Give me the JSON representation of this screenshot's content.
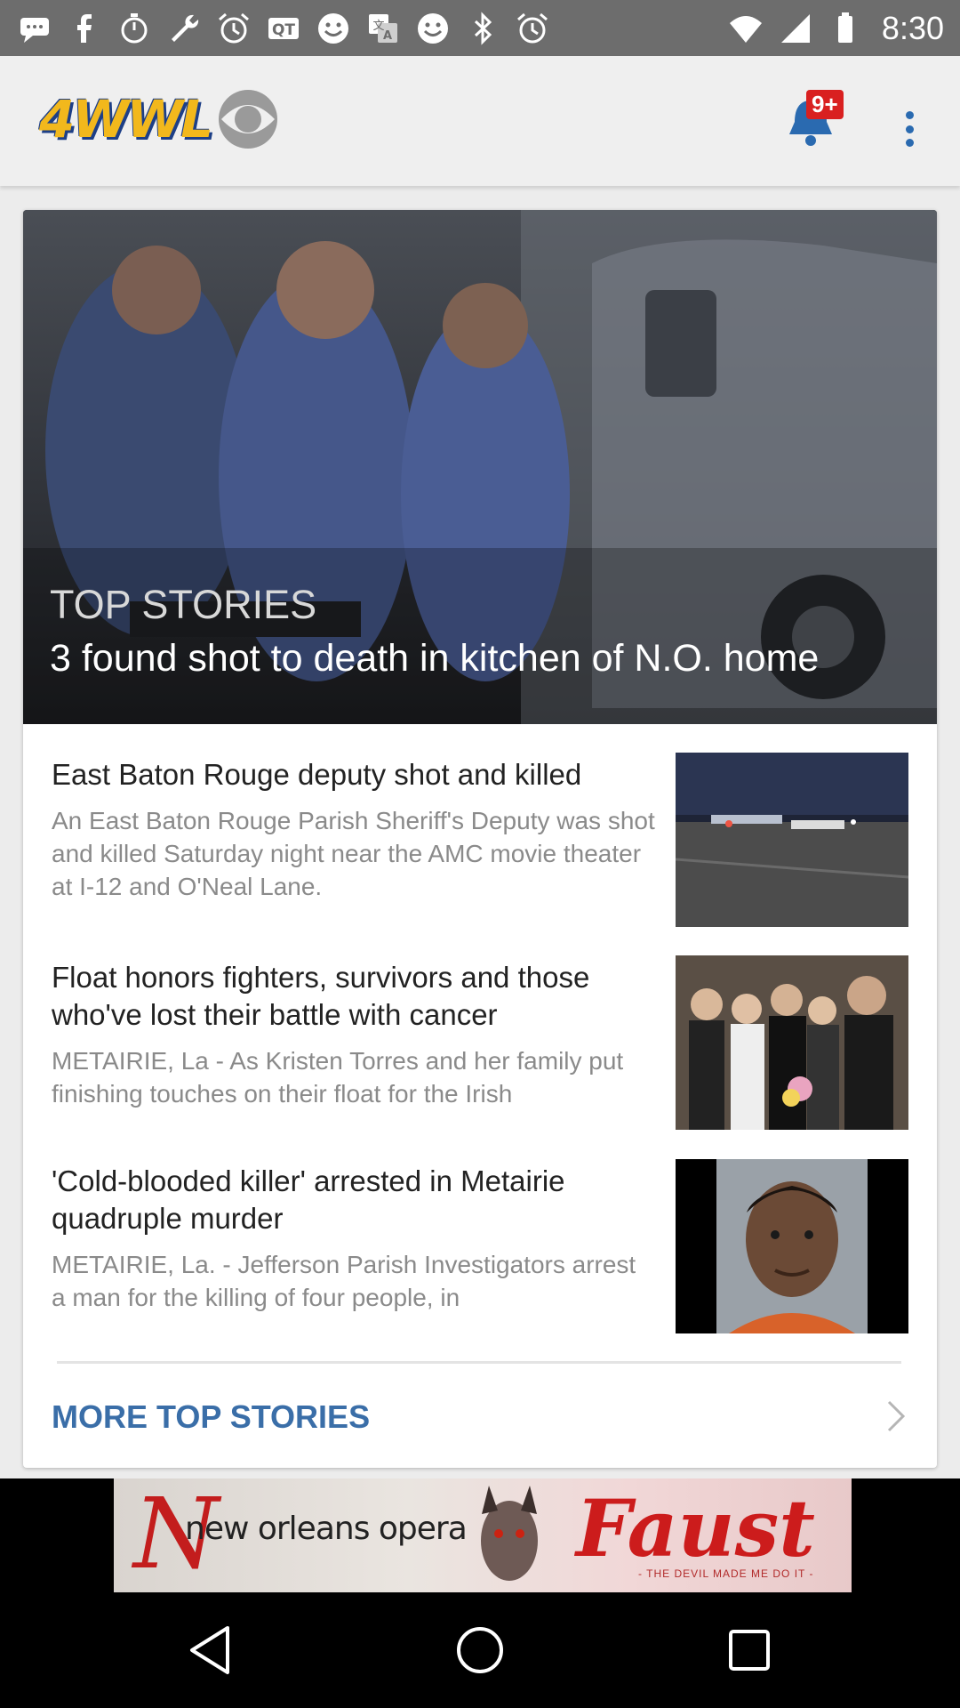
{
  "status_bar": {
    "time": "8:30",
    "left_icons": [
      "chat-bubble-icon",
      "facebook-icon",
      "timer-icon",
      "wrench-icon",
      "alarm-icon",
      "qt-icon",
      "smiley-icon",
      "translate-icon",
      "smiley-icon",
      "bluetooth-icon",
      "alarm-icon"
    ],
    "right_icons": [
      "wifi-icon",
      "signal-icon",
      "battery-icon"
    ]
  },
  "app_bar": {
    "logo_text": "4WWL",
    "notification_badge": "9+",
    "colors": {
      "logo_gold": "#f2b81c",
      "logo_blue": "#1d3f87",
      "accent_blue": "#2a6ab0",
      "badge_red": "#d92020"
    }
  },
  "hero": {
    "kicker": "TOP STORIES",
    "title": "3 found shot to death in kitchen of N.O. home"
  },
  "stories": [
    {
      "title": "East Baton Rouge deputy shot and killed",
      "summary": "An East Baton Rouge Parish Sheriff's Deputy was shot and killed Saturday night near the AMC movie theater at I-12 and O'Neal Lane."
    },
    {
      "title": "Float honors fighters, survivors and those who've lost their battle with cancer",
      "summary": "METAIRIE, La - As Kristen Torres and her family put finishing touches on their float for the Irish"
    },
    {
      "title": "'Cold-blooded killer' arrested in Metairie quadruple murder",
      "summary": "METAIRIE, La. - Jefferson Parish Investigators arrest a man for the killing of four people, in"
    }
  ],
  "more_link": {
    "label": "MORE TOP STORIES",
    "color": "#3a6ea8"
  },
  "ad": {
    "initial": "N",
    "org": "new orleans opera",
    "show": "Faust",
    "tagline": "- THE DEVIL MADE ME DO IT -"
  },
  "nav_bar": {
    "buttons": [
      "back-icon",
      "home-icon",
      "recents-icon"
    ]
  }
}
